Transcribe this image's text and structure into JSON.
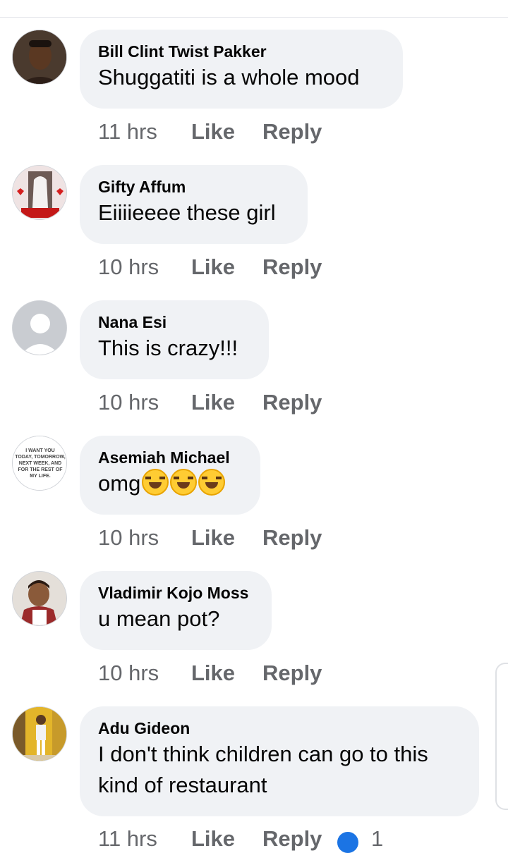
{
  "comments": [
    {
      "author": "Bill Clint Twist Pakker",
      "text": "Shuggatiti is a whole mood",
      "time": "11 hrs",
      "like_label": "Like",
      "reply_label": "Reply"
    },
    {
      "author": "Gifty Affum",
      "text": "Eiiiieeee these girl",
      "time": "10 hrs",
      "like_label": "Like",
      "reply_label": "Reply"
    },
    {
      "author": "Nana Esi",
      "text": "This is crazy!!!",
      "time": "10 hrs",
      "like_label": "Like",
      "reply_label": "Reply"
    },
    {
      "author": "Asemiah Michael",
      "text": "omg",
      "emoji": [
        "rolling-on-floor-laughing-emoji",
        "rolling-on-floor-laughing-emoji",
        "rolling-on-floor-laughing-emoji"
      ],
      "time": "10 hrs",
      "like_label": "Like",
      "reply_label": "Reply",
      "avatar_text": "I WANT YOU TODAY, TOMORROW, NEXT WEEK, AND FOR THE REST OF MY LIFE."
    },
    {
      "author": "Vladimir Kojo Moss",
      "text": "u mean pot?",
      "time": "10 hrs",
      "like_label": "Like",
      "reply_label": "Reply"
    },
    {
      "author": "Adu Gideon",
      "text_lines": [
        "I don't think children can go to this",
        "kind of restaurant"
      ],
      "time": "11 hrs",
      "like_label": "Like",
      "reply_label": "Reply",
      "reaction_icon": "like-reaction-icon",
      "reaction_count": "1"
    }
  ],
  "colors": {
    "bubble_bg": "#f0f2f5",
    "meta_text": "#65676b",
    "like_reaction": "#1b74e4"
  }
}
